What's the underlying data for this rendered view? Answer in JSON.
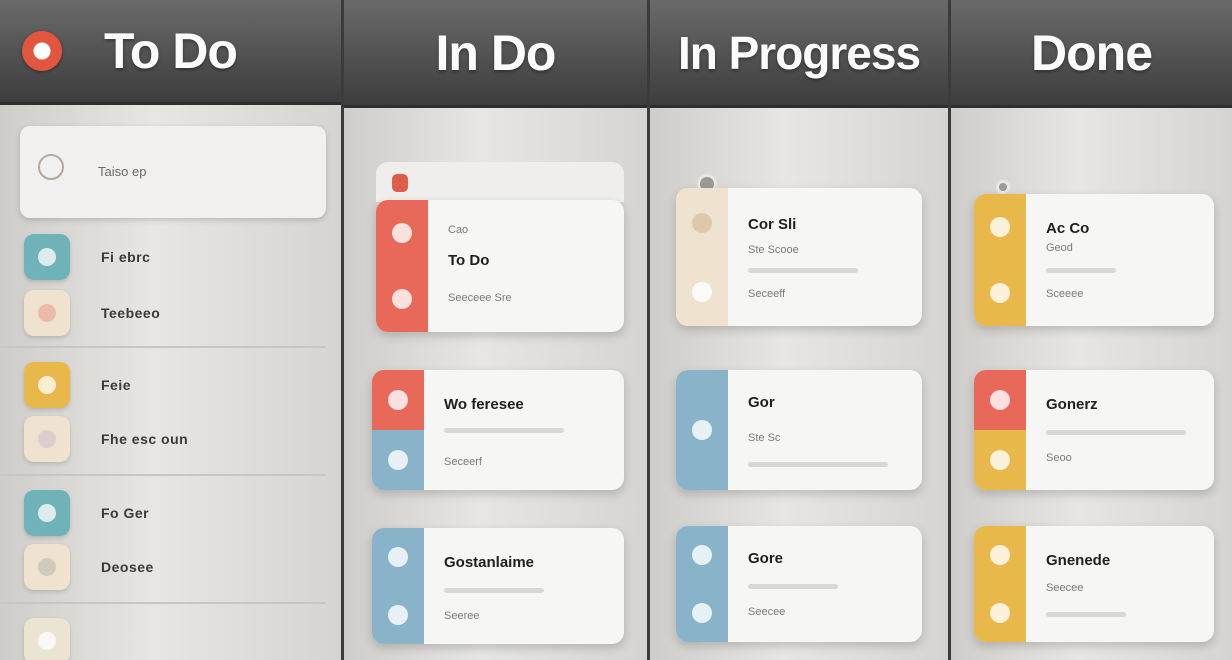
{
  "colors": {
    "red": "#e8685a",
    "teal": "#6fb3b8",
    "yellow": "#e9b84a",
    "blue": "#88b3c8",
    "cream": "#efe3d0",
    "header": "#555555"
  },
  "columns": [
    {
      "title": "To Do"
    },
    {
      "title": "In Do"
    },
    {
      "title": "In Progress"
    },
    {
      "title": "Done"
    }
  ],
  "todo": {
    "top_item": "Taiso ep",
    "groups": [
      {
        "a": "Fi ebrc",
        "b": "Teebeeo"
      },
      {
        "a": "Feie",
        "b": "Fhe esc oun"
      },
      {
        "a": "Fo Ger",
        "b": "Deosee"
      }
    ]
  },
  "in_do": {
    "cards": [
      {
        "t1": "Cao",
        "title": "To Do",
        "sub": "Seeceee Sre"
      },
      {
        "title": "Wo feresee",
        "sub": "Seceerf"
      },
      {
        "title": "Gostanlaime",
        "sub": "Seeree"
      }
    ]
  },
  "in_progress": {
    "cards": [
      {
        "title": "Cor Sli",
        "t2": "Ste Scooe",
        "sub": "Seceeff"
      },
      {
        "title": "Gor",
        "sub": "Ste Sc"
      },
      {
        "title": "Gore",
        "sub": "Seecee"
      }
    ]
  },
  "done": {
    "cards": [
      {
        "title": "Ac Co",
        "t2": "Geod",
        "sub": "Sceeee"
      },
      {
        "title": "Gonerz",
        "sub": "Seoo"
      },
      {
        "title": "Gnenede",
        "sub": "Seecee"
      }
    ]
  }
}
